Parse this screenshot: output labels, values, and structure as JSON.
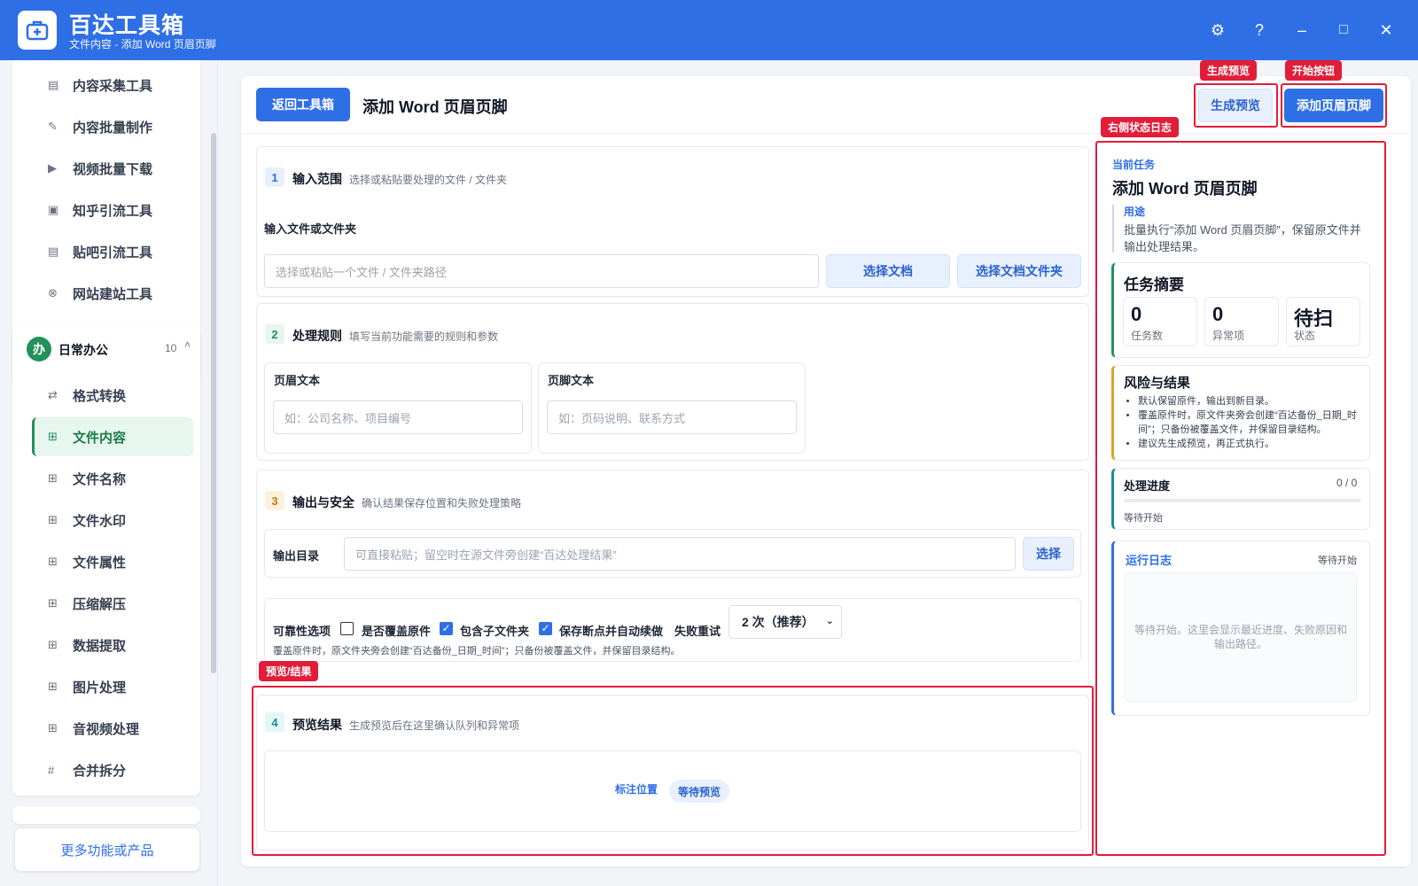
{
  "app": {
    "title": "百达工具箱",
    "subtitle": "文件内容 - 添加 Word 页眉页脚"
  },
  "window_controls": {
    "settings": "⚙",
    "help": "?",
    "minimize": "–",
    "maximize": "□",
    "close": "✕"
  },
  "sidebar": {
    "group1_items": [
      {
        "icon": "▤",
        "label": "内容采集工具"
      },
      {
        "icon": "✎",
        "label": "内容批量制作"
      },
      {
        "icon": "▶",
        "label": "视频批量下载"
      },
      {
        "icon": "▣",
        "label": "知乎引流工具"
      },
      {
        "icon": "▤",
        "label": "贴吧引流工具"
      },
      {
        "icon": "⊗",
        "label": "网站建站工具"
      }
    ],
    "group2": {
      "badge": "办",
      "title": "日常办公",
      "count": "10",
      "caret": "˄"
    },
    "group2_items": [
      {
        "icon": "⇄",
        "label": "格式转换"
      },
      {
        "icon": "⊞",
        "label": "文件内容"
      },
      {
        "icon": "⊞",
        "label": "文件名称"
      },
      {
        "icon": "⊞",
        "label": "文件水印"
      },
      {
        "icon": "⊞",
        "label": "文件属性"
      },
      {
        "icon": "⊞",
        "label": "压缩解压"
      },
      {
        "icon": "⊞",
        "label": "数据提取"
      },
      {
        "icon": "⊞",
        "label": "图片处理"
      },
      {
        "icon": "⊞",
        "label": "音视频处理"
      },
      {
        "icon": "#",
        "label": "合并拆分"
      }
    ],
    "active_item": "文件内容",
    "more_link": "更多功能或产品"
  },
  "header": {
    "back_button": "返回工具箱",
    "title": "添加 Word 页眉页脚",
    "preview_button": "生成预览",
    "start_button": "添加页眉页脚"
  },
  "annotations": {
    "preview_tag": "生成预览",
    "start_tag": "开始按钮",
    "log_tag": "右侧状态日志",
    "result_tag": "预览/结果"
  },
  "step1": {
    "num": "1",
    "title": "输入范围",
    "desc": "选择或粘贴要处理的文件 / 文件夹",
    "field_label": "输入文件或文件夹",
    "placeholder": "选择或粘贴一个文件 / 文件夹路径",
    "btn_file": "选择文档",
    "btn_folder": "选择文档文件夹"
  },
  "step2": {
    "num": "2",
    "title": "处理规则",
    "desc": "填写当前功能需要的规则和参数",
    "header_label": "页眉文本",
    "header_placeholder": "如：公司名称、项目编号",
    "footer_label": "页脚文本",
    "footer_placeholder": "如：页码说明、联系方式"
  },
  "step3": {
    "num": "3",
    "title": "输出与安全",
    "desc": "确认结果保存位置和失败处理策略",
    "output_label": "输出目录",
    "output_placeholder": "可直接粘贴；留空时在源文件旁创建“百达处理结果”",
    "output_btn": "选择",
    "reliability_label": "可靠性选项",
    "opt_overwrite": "是否覆盖原件",
    "opt_overwrite_checked": false,
    "opt_subfolders": "包含子文件夹",
    "opt_subfolders_checked": true,
    "opt_resume": "保存断点并自动续做",
    "opt_resume_checked": true,
    "retry_label": "失败重试",
    "retry_value": "2 次（推荐）",
    "note": "覆盖原件时，原文件夹旁会创建“百达备份_日期_时间”；只备份被覆盖文件，并保留目录结构。"
  },
  "step4": {
    "num": "4",
    "title": "预览结果",
    "desc": "生成预览后在这里确认队列和异常项",
    "mark_label": "标注位置",
    "status_pill": "等待预览"
  },
  "right": {
    "current_task_label": "当前任务",
    "task_title": "添加 Word 页眉页脚",
    "purpose_label": "用途",
    "purpose_text": "批量执行“添加 Word 页眉页脚”，保留原文件并输出处理结果。",
    "summary_title": "任务摘要",
    "stats": [
      {
        "value": "0",
        "label": "任务数"
      },
      {
        "value": "0",
        "label": "异常项"
      },
      {
        "value": "待扫",
        "label": "状态"
      }
    ],
    "risk_title": "风险与结果",
    "risk_items": [
      "默认保留原件，输出到新目录。",
      "覆盖原件时，原文件夹旁会创建“百达备份_日期_时间”；只备份被覆盖文件，并保留目录结构。",
      "建议先生成预览，再正式执行。"
    ],
    "progress_title": "处理进度",
    "progress_count": "0 / 0",
    "progress_value": 0,
    "progress_status": "等待开始",
    "log_title": "运行日志",
    "log_status": "等待开始",
    "log_placeholder": "等待开始。这里会显示最近进度、失败原因和输出路径。"
  },
  "colors": {
    "brand": "#2f6fe6",
    "accent_green": "#23915a",
    "annotation_red": "#e11d3a"
  }
}
